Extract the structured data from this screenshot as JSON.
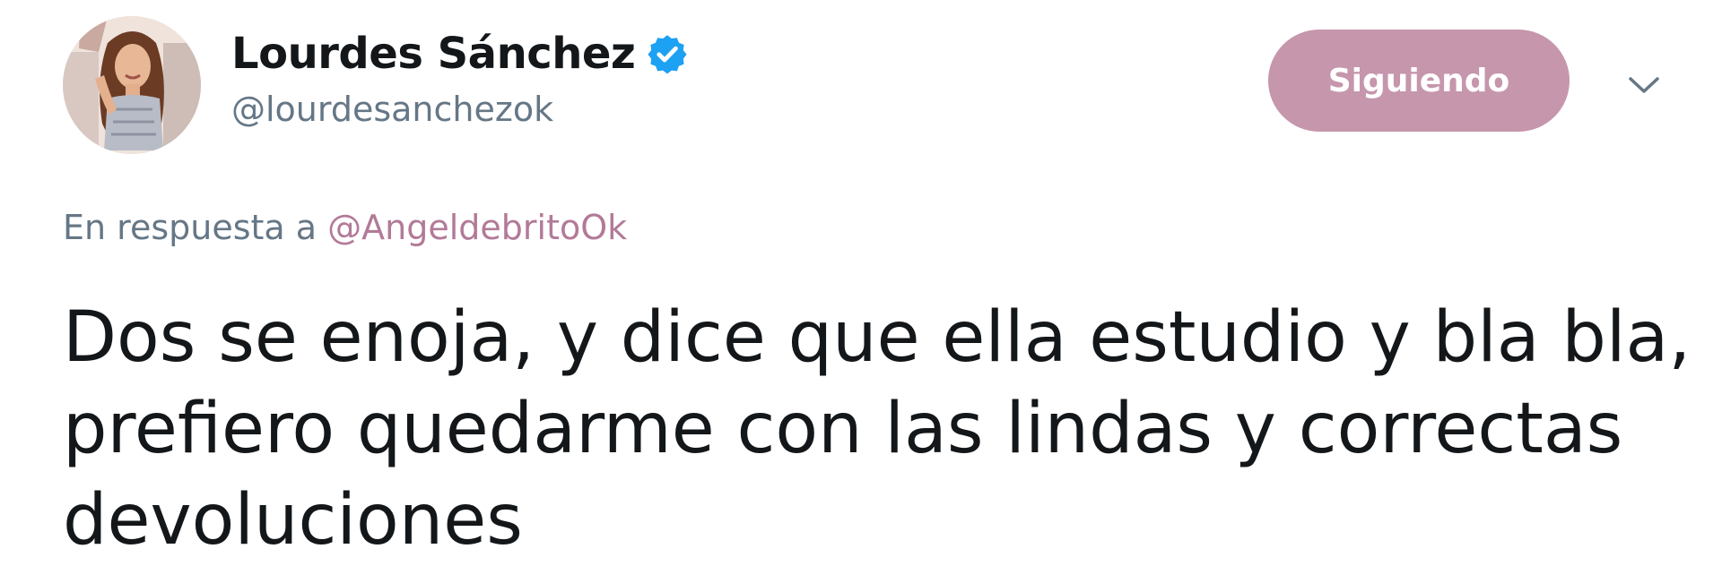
{
  "tweet": {
    "author": {
      "display_name": "Lourdes Sánchez",
      "username": "@lourdesanchezok",
      "verified_icon": "verified-badge-icon",
      "verified_color": "#1da1f2",
      "avatar_icon": "profile-photo"
    },
    "follow_button": {
      "label": "Siguiendo",
      "color": "#c596ac"
    },
    "menu_icon": "chevron-down-icon",
    "reply_context": {
      "prefix": "En respuesta a",
      "handle": "@AngeldebritoOk",
      "handle_color": "#b27a98"
    },
    "text": "Dos se enoja, y dice que ella estudio y bla bla,\nprefiero quedarme con las lindas y correctas\ndevoluciones"
  }
}
